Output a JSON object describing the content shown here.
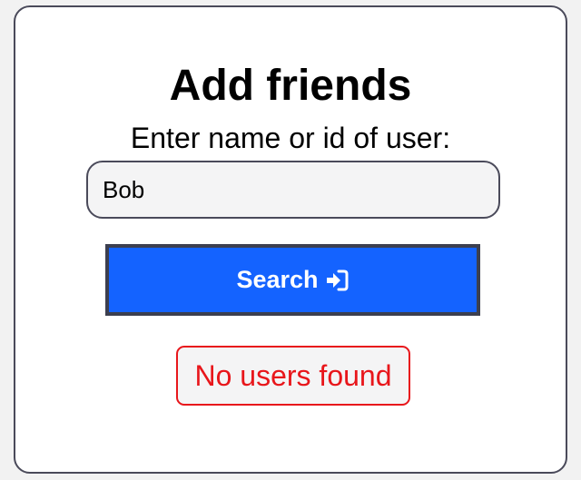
{
  "card": {
    "title": "Add friends",
    "prompt": "Enter name or id of user:"
  },
  "search": {
    "value": "Bob",
    "button_label": "Search",
    "button_icon": "sign-in-icon"
  },
  "status": {
    "message": "No users found"
  },
  "colors": {
    "button_bg": "#1463ff",
    "error": "#e8161b"
  }
}
